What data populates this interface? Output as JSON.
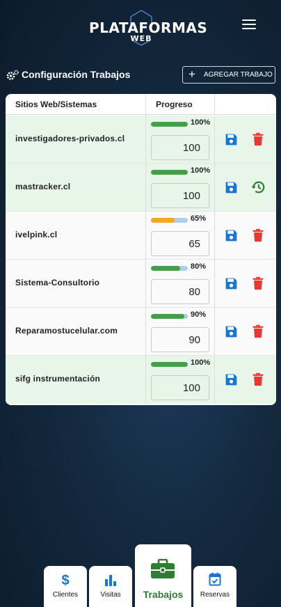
{
  "logo": {
    "line1": "PLATAFORMAS",
    "line2": "WEB"
  },
  "page": {
    "title": "Configuración Trabajos",
    "add_button": "AGREGAR TRABAJO"
  },
  "table": {
    "headers": [
      "Sitios Web/Sistemas",
      "Progreso"
    ],
    "rows": [
      {
        "name": "investigadores-privados.cl",
        "percent_label": "100%",
        "value": "100",
        "progress": 100,
        "bar_color": "#43a047",
        "bg": "green",
        "secondary_action": "delete-icon"
      },
      {
        "name": "mastracker.cl",
        "percent_label": "100%",
        "value": "100",
        "progress": 100,
        "bar_color": "#43a047",
        "bg": "green",
        "secondary_action": "restore-history-icon"
      },
      {
        "name": "ivelpink.cl",
        "percent_label": "65%",
        "value": "65",
        "progress": 65,
        "bar_color": "#f5a623",
        "bg": "white",
        "secondary_action": "delete-icon"
      },
      {
        "name": "Sistema-Consultorio",
        "percent_label": "80%",
        "value": "80",
        "progress": 80,
        "bar_color": "#43a047",
        "bg": "white",
        "secondary_action": "delete-icon"
      },
      {
        "name": "Reparamostucelular.com",
        "percent_label": "90%",
        "value": "90",
        "progress": 90,
        "bar_color": "#43a047",
        "bg": "white",
        "secondary_action": "delete-icon"
      },
      {
        "name": "sifg instrumentación",
        "percent_label": "100%",
        "value": "100",
        "progress": 100,
        "bar_color": "#43a047",
        "bg": "green",
        "secondary_action": "delete-icon"
      }
    ]
  },
  "nav": {
    "clientes": "Clientes",
    "visitas": "Visitas",
    "trabajos": "Trabajos",
    "reservas": "Reservas"
  },
  "colors": {
    "accent_green": "#2e7d32",
    "save_blue": "#1976d2",
    "delete_red": "#e53935",
    "background_dark": "#0c1b2b"
  }
}
